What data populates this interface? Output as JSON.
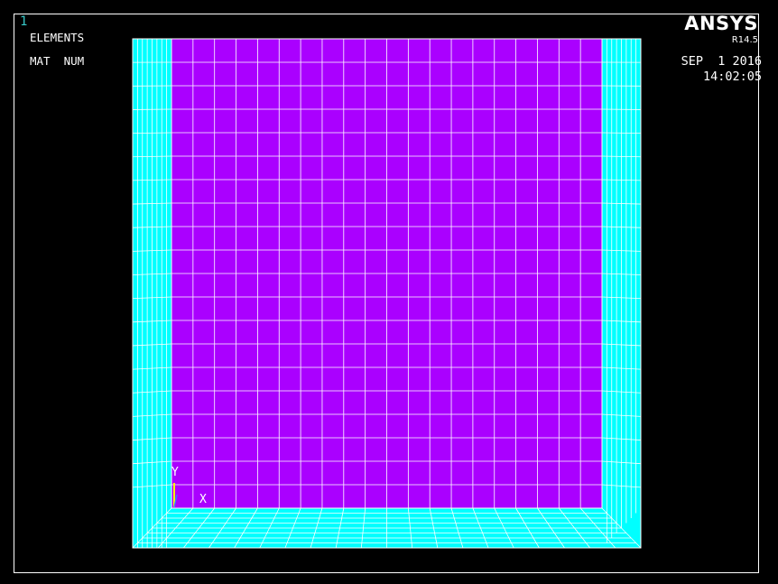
{
  "window": {
    "number": "1"
  },
  "legend": {
    "title": "ELEMENTS",
    "subtitle": "MAT  NUM"
  },
  "branding": {
    "logo": "ANSYS",
    "release": "R14.5"
  },
  "timestamp": {
    "date": "SEP  1 2016",
    "time": "14:02:05"
  },
  "triad": {
    "y_label": "Y",
    "x_label": "X"
  },
  "colors": {
    "background": "#000000",
    "frame": "#ffffff",
    "material_1": "#aa00ff",
    "material_2": "#00ffff",
    "mesh_lines": "#ffffff",
    "window_number": "#37c8c8",
    "triad_y": "#ffff00"
  },
  "mesh": {
    "inner_columns": 20,
    "inner_rows": 20,
    "wall_divisions": 8
  }
}
